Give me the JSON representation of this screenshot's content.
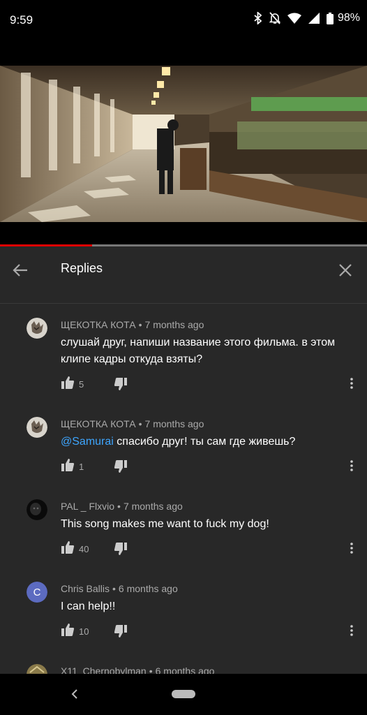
{
  "status_bar": {
    "time": "9:59",
    "battery": "98%",
    "icons": [
      "bluetooth-icon",
      "notifications-off-icon",
      "wifi-icon",
      "signal-icon",
      "battery-icon"
    ]
  },
  "video": {
    "progress": 0.25,
    "progress_color": "#e00000"
  },
  "replies_panel": {
    "title": "Replies",
    "comments": [
      {
        "author": "ЩЕКОТКА КОТА",
        "time": "7 months ago",
        "text": "слушай друг, напиши название этого фильма. в этом клипе кадры откуда взяты?",
        "likes": "5"
      },
      {
        "author": "ЩЕКОТКА КОТА",
        "time": "7 months ago",
        "mention": "@Samurai",
        "text": " спасибо друг! ты сам где живешь?",
        "likes": "1"
      },
      {
        "author": "PAL _ Flxvio",
        "time": "7 months ago",
        "text": "This song makes me want to fuck my dog!",
        "likes": "40"
      },
      {
        "author": "Chris Ballis",
        "time": "6 months ago",
        "avatar_letter": "C",
        "text": "I can help!!",
        "likes": "10"
      },
      {
        "author": "X11_Chernobylman",
        "time": "6 months ago"
      }
    ],
    "separator": "•"
  },
  "colors": {
    "panel_bg": "#282828",
    "mention": "#3ea6ff",
    "avatar_c": "#5c6bc0"
  }
}
